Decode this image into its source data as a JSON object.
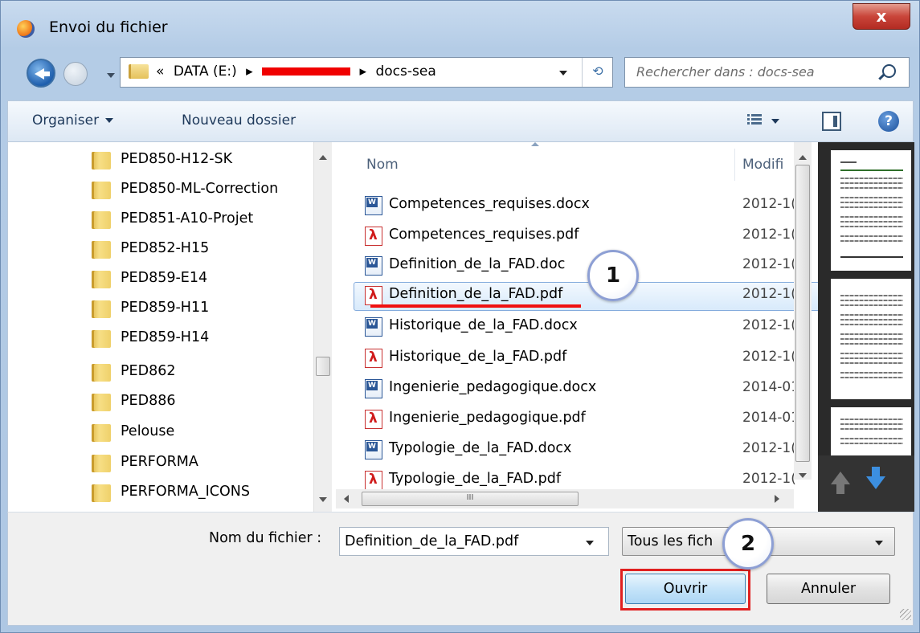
{
  "window": {
    "title": "Envoi du fichier",
    "close_label": "x"
  },
  "nav": {
    "breadcrumb": [
      "«",
      "DATA (E:)",
      "▸",
      "▸",
      "docs-sea"
    ],
    "search_placeholder": "Rechercher dans : docs-sea"
  },
  "toolbar": {
    "organize_label": "Organiser",
    "new_folder_label": "Nouveau dossier",
    "help_label": "?"
  },
  "folders": [
    "PED850-H12-SK",
    "PED850-ML-Correction",
    "PED851-A10-Projet",
    "PED852-H15",
    "PED859-E14",
    "PED859-H11",
    "PED859-H14",
    "PED862",
    "PED886",
    "Pelouse",
    "PERFORMA",
    "PERFORMA_ICONS"
  ],
  "file_list": {
    "columns": [
      "Nom",
      "Modifi"
    ],
    "scrollbar_grip": "III",
    "files": [
      {
        "name": "Competences_requises.docx",
        "date": "2012-1(",
        "type": "word"
      },
      {
        "name": "Competences_requises.pdf",
        "date": "2012-1(",
        "type": "pdf"
      },
      {
        "name": "Definition_de_la_FAD.doc",
        "date": "2012-1(",
        "type": "word"
      },
      {
        "name": "Definition_de_la_FAD.pdf",
        "date": "2012-1(",
        "type": "pdf",
        "selected": true
      },
      {
        "name": "Historique_de_la_FAD.docx",
        "date": "2012-1(",
        "type": "word"
      },
      {
        "name": "Historique_de_la_FAD.pdf",
        "date": "2012-1(",
        "type": "pdf"
      },
      {
        "name": "Ingenierie_pedagogique.docx",
        "date": "2014-01",
        "type": "word"
      },
      {
        "name": "Ingenierie_pedagogique.pdf",
        "date": "2014-01",
        "type": "pdf"
      },
      {
        "name": "Typologie_de_la_FAD.docx",
        "date": "2012-1(",
        "type": "word"
      },
      {
        "name": "Typologie_de_la_FAD.pdf",
        "date": "2012-1(",
        "type": "pdf"
      }
    ]
  },
  "bottom": {
    "filename_label": "Nom du fichier :",
    "filename_value": "Definition_de_la_FAD.pdf",
    "filetype_value": "Tous les fich",
    "open_label": "Ouvrir",
    "cancel_label": "Annuler"
  },
  "annotations": {
    "step1": "1",
    "step2": "2",
    "accent_color": "#e02020"
  }
}
